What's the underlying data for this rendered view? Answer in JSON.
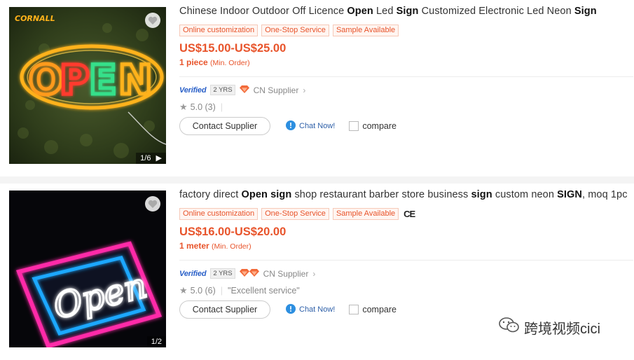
{
  "colors": {
    "accent": "#e8542b",
    "verified": "#2a60c8",
    "chat": "#2d5fa8"
  },
  "products": [
    {
      "image_counter": "1/6",
      "image_brand": "CORNALL",
      "image_sign_text": "OPEN",
      "title_segments": [
        {
          "text": "Chinese Indoor Outdoor Off Licence ",
          "bold": false
        },
        {
          "text": "Open",
          "bold": true
        },
        {
          "text": " Led ",
          "bold": false
        },
        {
          "text": "Sign",
          "bold": true
        },
        {
          "text": " Customized Electronic Led Neon ",
          "bold": false
        },
        {
          "text": "Sign",
          "bold": true
        }
      ],
      "tags": [
        "Online customization",
        "One-Stop Service",
        "Sample Available"
      ],
      "price": "US$15.00-US$25.00",
      "moq_qty": "1 piece",
      "moq_label": "(Min. Order)",
      "verified": "Verified",
      "years": "2 YRS",
      "supplier_country": "CN Supplier",
      "rating": "5.0 (3)",
      "review": "",
      "contact_label": "Contact Supplier",
      "chat_label": "Chat Now!",
      "compare_label": "compare"
    },
    {
      "image_counter": "1/2",
      "image_sign_text": "Open",
      "title_segments": [
        {
          "text": "factory direct ",
          "bold": false
        },
        {
          "text": "Open sign",
          "bold": true
        },
        {
          "text": " shop restaurant barber store business ",
          "bold": false
        },
        {
          "text": "sign",
          "bold": true
        },
        {
          "text": " custom neon ",
          "bold": false
        },
        {
          "text": "SIGN",
          "bold": true
        },
        {
          "text": ", moq 1pc",
          "bold": false
        }
      ],
      "tags": [
        "Online customization",
        "One-Stop Service",
        "Sample Available"
      ],
      "ce_mark": "CE",
      "price": "US$16.00-US$20.00",
      "moq_qty": "1 meter",
      "moq_label": "(Min. Order)",
      "verified": "Verified",
      "years": "2 YRS",
      "supplier_country": "CN Supplier",
      "rating": "5.0 (6)",
      "review": "\"Excellent service\"",
      "contact_label": "Contact Supplier",
      "chat_label": "Chat Now!",
      "compare_label": "compare"
    }
  ],
  "watermark": "跨境视频cici"
}
